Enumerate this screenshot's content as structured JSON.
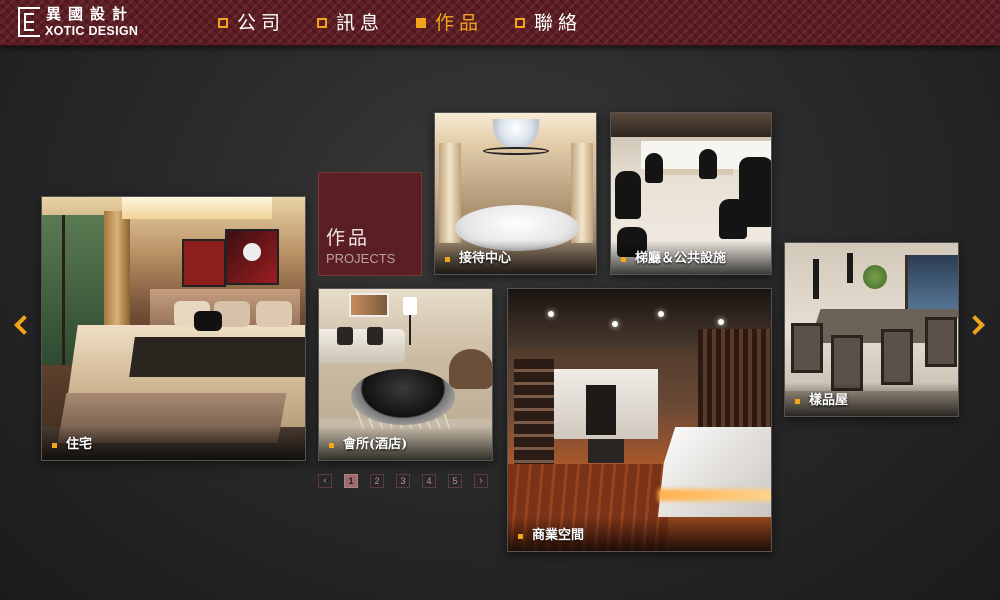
{
  "header": {
    "logo": {
      "cn": "異國設計",
      "en": "XOTIC DESIGN"
    },
    "nav": [
      {
        "label": "公司",
        "active": false
      },
      {
        "label": "訊息",
        "active": false
      },
      {
        "label": "作品",
        "active": true
      },
      {
        "label": "聯絡",
        "active": false
      }
    ]
  },
  "projects_box": {
    "title_cn": "作品",
    "title_en": "PROJECTS"
  },
  "tiles": {
    "residential": {
      "caption": "住宅",
      "icon": "bedroom-photo"
    },
    "reception": {
      "caption": "接待中心",
      "icon": "reception-lobby-photo"
    },
    "dining_facilities": {
      "caption": "梯廳＆公共設施",
      "icon": "dining-area-photo"
    },
    "clubhouse": {
      "caption": "會所(酒店)",
      "icon": "lounge-photo"
    },
    "commercial": {
      "caption": "商業空間",
      "icon": "retail-store-photo"
    },
    "showroom": {
      "caption": "樣品屋",
      "icon": "dining-room-photo"
    }
  },
  "pager": {
    "prev": "‹",
    "pages": [
      "1",
      "2",
      "3",
      "4",
      "5"
    ],
    "current": "1",
    "next": "›"
  },
  "colors": {
    "accent": "#f2a51a",
    "header_bg": "#5c1c22",
    "projects_bg": "#5a1e23",
    "background": "#2a2a2a"
  }
}
